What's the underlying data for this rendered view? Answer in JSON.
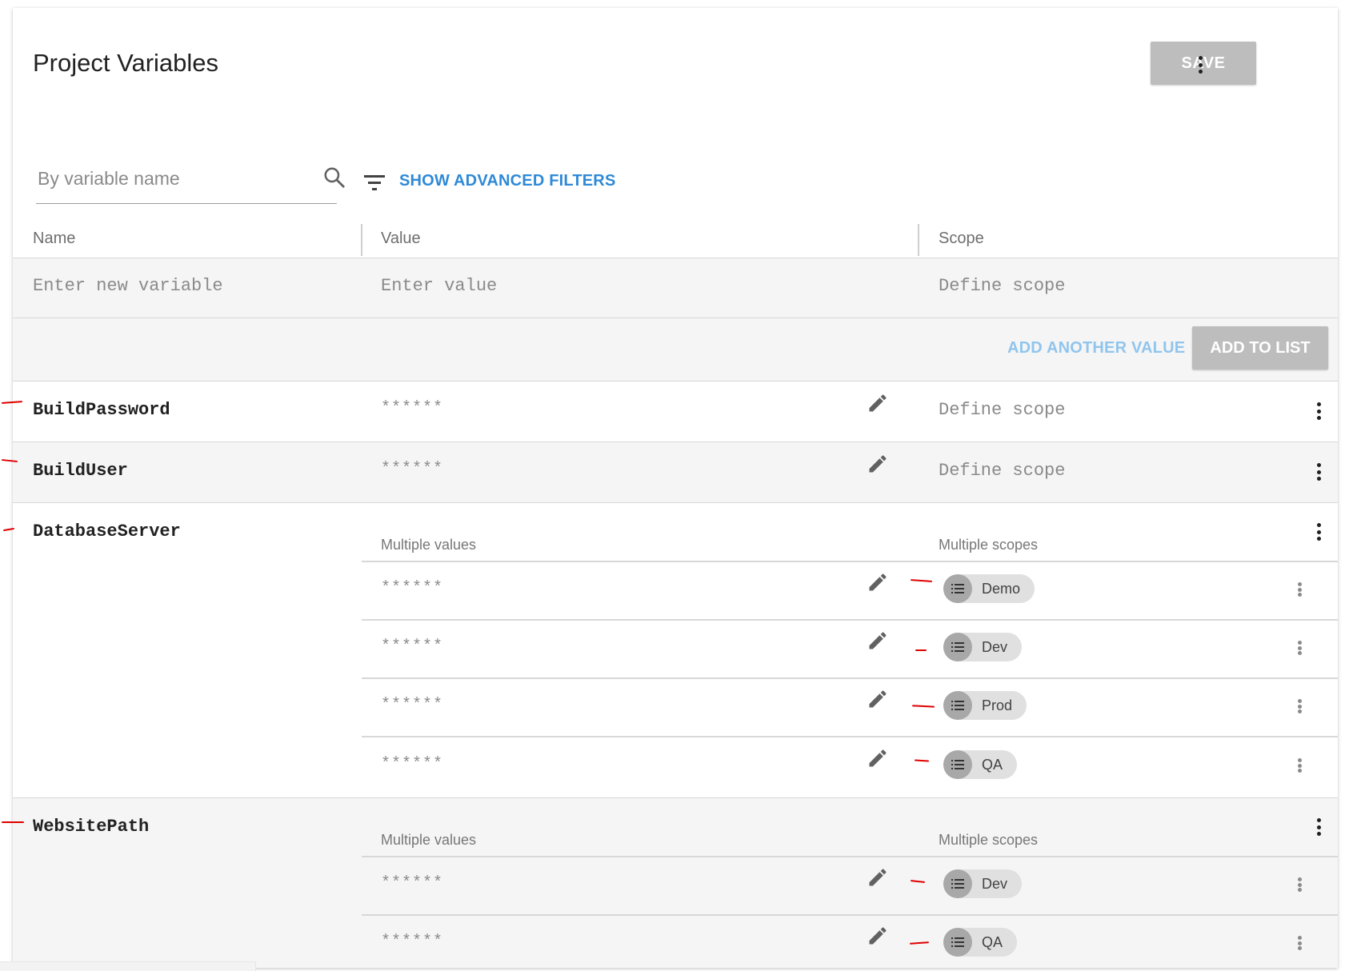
{
  "header": {
    "title": "Project Variables",
    "save_label": "SAVE"
  },
  "filters": {
    "search_placeholder": "By variable name",
    "advanced_label": "SHOW ADVANCED FILTERS"
  },
  "columns": [
    "Name",
    "Value",
    "Scope"
  ],
  "new_variable": {
    "name_placeholder": "Enter new variable",
    "value_placeholder": "Enter value",
    "scope_placeholder": "Define scope",
    "add_another_label": "ADD ANOTHER VALUE",
    "add_to_list_label": "ADD TO LIST"
  },
  "masked_value": "******",
  "labels": {
    "multiple_values": "Multiple values",
    "multiple_scopes": "Multiple scopes",
    "define_scope": "Define scope"
  },
  "variables": [
    {
      "name": "BuildPassword"
    },
    {
      "name": "BuildUser"
    },
    {
      "name": "DatabaseServer",
      "scopes": [
        "Demo",
        "Dev",
        "Prod",
        "QA"
      ]
    },
    {
      "name": "WebsitePath",
      "scopes": [
        "Dev",
        "QA"
      ]
    }
  ],
  "colors": {
    "accent_link": "#2f8ad6",
    "disabled_button": "#bdbdbd",
    "annotation_red": "#e00000"
  }
}
